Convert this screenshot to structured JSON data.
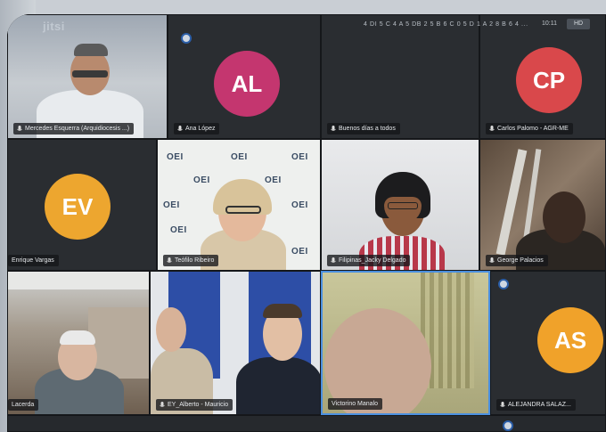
{
  "app": {
    "logo": "jitsi",
    "meeting_id": "4 DI 5 C 4 A 5 DB 2 5 B 6 C 0 5 D 1 A 2 8 B 6 4 ...",
    "clock": "10:11",
    "badge": "HD"
  },
  "participants": [
    {
      "id": "p1",
      "name": "Mercedes Esquerra (Arquidiocesis ...)",
      "type": "video"
    },
    {
      "id": "p2",
      "name": "Ana López",
      "type": "avatar",
      "initials": "AL",
      "color": "#c4366f"
    },
    {
      "id": "p3",
      "name": "Buenos días a todos",
      "type": "blank"
    },
    {
      "id": "p4",
      "name": "Carlos Palomo - AGR-ME",
      "type": "avatar",
      "initials": "CP",
      "color": "#d9484b"
    },
    {
      "id": "p5",
      "name": "Enrique Vargas",
      "type": "avatar",
      "initials": "EV",
      "color": "#eda62f"
    },
    {
      "id": "p6",
      "name": "Teófilo Ribeiro",
      "type": "video"
    },
    {
      "id": "p7",
      "name": "Filipinas_Jacky Delgado",
      "type": "video"
    },
    {
      "id": "p8",
      "name": "George Palacios",
      "type": "video"
    },
    {
      "id": "p9",
      "name": "Lacerda",
      "type": "video"
    },
    {
      "id": "p10",
      "name": "EY_Alberto - Mauricio",
      "type": "video"
    },
    {
      "id": "p11",
      "name": "Victorino Manalo",
      "type": "video"
    },
    {
      "id": "p12",
      "name": "ALEJANDRA SALAZ...",
      "type": "avatar",
      "initials": "AS",
      "color": "#f0a22a"
    }
  ],
  "oei_label": "OEI",
  "colors": {
    "active_border": "#4a8fe0",
    "tile_bg": "#2a2d31"
  }
}
